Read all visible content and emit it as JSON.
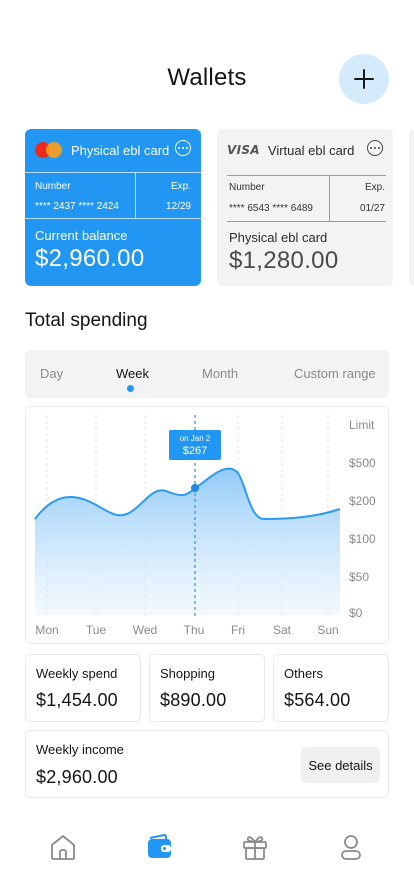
{
  "header": {
    "title": "Wallets"
  },
  "cards": [
    {
      "brand": "mastercard",
      "name": "Physical ebl card",
      "number_label": "Number",
      "number": "**** 2437 **** 2424",
      "exp_label": "Exp.",
      "exp": "12/29",
      "balance_label": "Current balance",
      "balance": "$2,960.00",
      "color": "#2196f3"
    },
    {
      "brand": "visa",
      "brand_text": "VISA",
      "name": "Virtual ebl card",
      "number_label": "Number",
      "number": "**** 6543 **** 6489",
      "exp_label": "Exp.",
      "exp": "01/27",
      "balance_label": "Physical ebl card",
      "balance": "$1,280.00"
    }
  ],
  "spending": {
    "title": "Total spending",
    "tabs": [
      "Day",
      "Week",
      "Month",
      "Custom range"
    ],
    "active_tab": "Week"
  },
  "chart_data": {
    "type": "area",
    "x": [
      "Mon",
      "Tue",
      "Wed",
      "Thu",
      "Fri",
      "Sat",
      "Sun"
    ],
    "y_ticks": [
      "Limit",
      "$500",
      "$200",
      "$100",
      "$50",
      "$0"
    ],
    "tooltip": {
      "date": "on Jan 2",
      "value": "$267"
    },
    "accent": "#2196f3"
  },
  "stats": [
    {
      "label": "Weekly spend",
      "value": "$1,454.00"
    },
    {
      "label": "Shopping",
      "value": "$890.00"
    },
    {
      "label": "Others",
      "value": "$564.00"
    }
  ],
  "income": {
    "label": "Weekly income",
    "value": "$2,960.00",
    "button": "See details"
  },
  "nav": [
    {
      "icon": "home-icon"
    },
    {
      "icon": "wallet-icon",
      "active": true
    },
    {
      "icon": "gift-icon"
    },
    {
      "icon": "profile-icon"
    }
  ]
}
